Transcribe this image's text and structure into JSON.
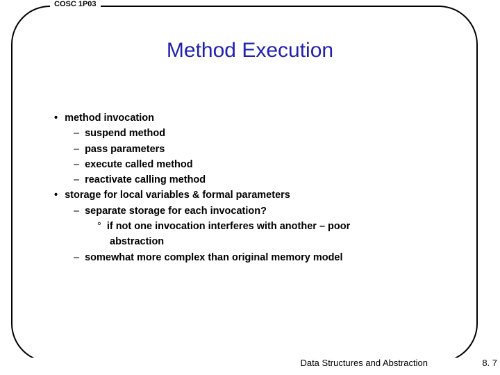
{
  "course": "COSC 1P03",
  "title": "Method Execution",
  "bullets": {
    "b1a": "method invocation",
    "b2a": "suspend method",
    "b2b": "pass parameters",
    "b2c": "execute called method",
    "b2d": "reactivate calling method",
    "b1b": "storage for local variables & formal parameters",
    "b2e": "separate storage for each invocation?",
    "b3a": "if not one invocation interferes with another – poor",
    "b3a_cont": "abstraction",
    "b2f": "somewhat more complex than original memory model"
  },
  "footer": "Data Structures and Abstraction",
  "page": "8. 7"
}
